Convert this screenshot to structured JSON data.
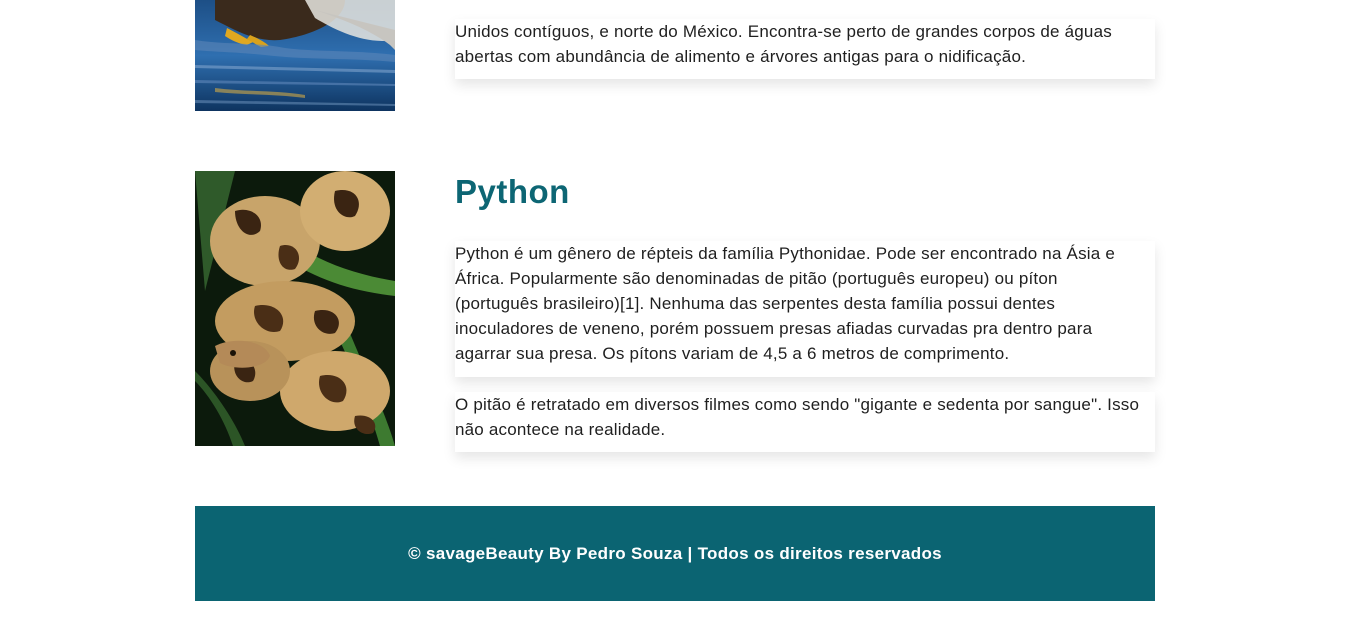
{
  "eagle": {
    "image_alt": "bald-eagle-photo",
    "description": "Unidos contíguos, e norte do México. Encontra-se perto de grandes corpos de águas abertas com abundância de alimento e árvores antigas para o nidificação."
  },
  "python": {
    "title": "Python",
    "image_alt": "python-snake-photo",
    "paragraph_1": "Python é um gênero de répteis da família Pythonidae. Pode ser encontrado na Ásia e África. Popularmente são denominadas de pitão (português europeu) ou píton (português brasileiro)[1]. Nenhuma das serpentes desta família possui dentes inoculadores de veneno, porém possuem presas afiadas curvadas pra dentro para agarrar sua presa. Os pítons variam de 4,5 a 6 metros de comprimento.",
    "paragraph_2": "O pitão é retratado em diversos filmes como sendo \"gigante e sedenta por sangue\". Isso não acontece na realidade."
  },
  "footer": {
    "text": "© savageBeauty By Pedro Souza | Todos os direitos reservados",
    "background": "#0b6472"
  },
  "colors": {
    "heading": "#0d6674"
  }
}
